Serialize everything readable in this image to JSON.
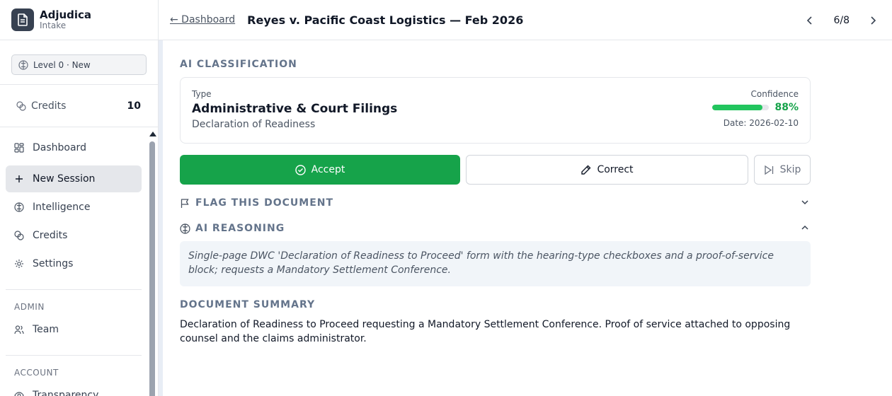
{
  "app": {
    "name": "Adjudica",
    "subtitle": "Intake"
  },
  "sidebar": {
    "level_badge": "Level 0 · New",
    "credits": {
      "label": "Credits",
      "value": "10"
    },
    "nav": [
      {
        "label": "Dashboard",
        "icon": "dashboard-icon"
      },
      {
        "label": "New Session",
        "icon": "plus-icon",
        "active": true
      },
      {
        "label": "Intelligence",
        "icon": "brain-icon"
      },
      {
        "label": "Credits",
        "icon": "coins-icon"
      },
      {
        "label": "Settings",
        "icon": "gear-icon"
      }
    ],
    "admin_section": "ADMIN",
    "admin_nav": [
      {
        "label": "Team",
        "icon": "users-icon"
      }
    ],
    "account_section": "ACCOUNT",
    "account_nav": [
      {
        "label": "Transparency",
        "icon": "eye-icon"
      }
    ]
  },
  "header": {
    "back_label": "← Dashboard",
    "title": "Reyes v. Pacific Coast Logistics — Feb 2026",
    "pager": "6/8"
  },
  "classification": {
    "section_title": "AI CLASSIFICATION",
    "type_label": "Type",
    "type": "Administrative & Court Filings",
    "subtype": "Declaration of Readiness",
    "confidence_label": "Confidence",
    "confidence_value": "88%",
    "confidence_fraction": 0.88,
    "date": "Date: 2026-02-10"
  },
  "actions": {
    "accept": "Accept",
    "correct": "Correct",
    "skip": "Skip"
  },
  "flag": {
    "title": "FLAG THIS DOCUMENT"
  },
  "reasoning": {
    "title": "AI REASONING",
    "text": "Single-page DWC 'Declaration of Readiness to Proceed' form with the hearing-type checkboxes and a proof-of-service block; requests a Mandatory Settlement Conference."
  },
  "summary": {
    "title": "DOCUMENT SUMMARY",
    "text": "Declaration of Readiness to Proceed requesting a Mandatory Settlement Conference. Proof of service attached to opposing counsel and the claims administrator."
  },
  "colors": {
    "accent_green": "#16a34a",
    "confidence_bar": "#22c55e",
    "logo_bg": "#374151"
  }
}
